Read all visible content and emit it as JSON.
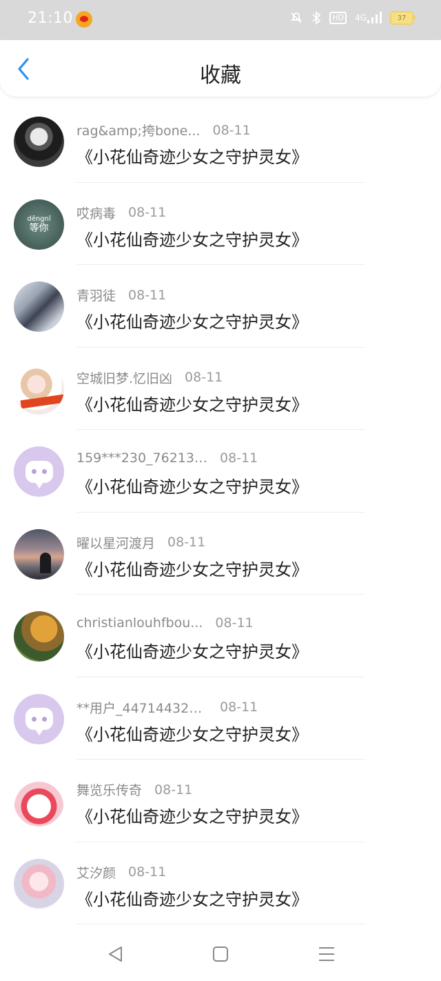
{
  "status_bar": {
    "time": "21:10",
    "icons": [
      "weibo-icon",
      "mute-icon",
      "bluetooth-icon",
      "hd-icon",
      "signal-4g-icon",
      "battery-icon"
    ],
    "hd_label": "HD",
    "network_label": "4G",
    "battery_level": "37"
  },
  "header": {
    "title": "收藏",
    "back_icon": "chevron-left-icon"
  },
  "favorites": [
    {
      "user": "rag&amp;挎bone...",
      "date": "08-11",
      "book": "《小花仙奇迹少女之守护灵女》"
    },
    {
      "user": "哎病毒",
      "date": "08-11",
      "book": "《小花仙奇迹少女之守护灵女》"
    },
    {
      "user": "青羽徒",
      "date": "08-11",
      "book": "《小花仙奇迹少女之守护灵女》"
    },
    {
      "user": "空城旧梦.忆旧凶",
      "date": "08-11",
      "book": "《小花仙奇迹少女之守护灵女》"
    },
    {
      "user": "159***230_762132...",
      "date": "08-11",
      "book": "《小花仙奇迹少女之守护灵女》"
    },
    {
      "user": "曜以星河渡月",
      "date": "08-11",
      "book": "《小花仙奇迹少女之守护灵女》"
    },
    {
      "user": "christianlouhfbou...",
      "date": "08-11",
      "book": "《小花仙奇迹少女之守护灵女》"
    },
    {
      "user": "**用户_447144323...",
      "date": "08-11",
      "book": "《小花仙奇迹少女之守护灵女》"
    },
    {
      "user": "舞览乐传奇",
      "date": "08-11",
      "book": "《小花仙奇迹少女之守护灵女》"
    },
    {
      "user": "艾汐颜",
      "date": "08-11",
      "book": "《小花仙奇迹少女之守护灵女》"
    }
  ],
  "avatar_texts": {
    "pinyin": "děngnǐ",
    "chars": "等你"
  },
  "nav_bar": {
    "back": "triangle-back-icon",
    "home": "square-home-icon",
    "menu": "menu-lines-icon"
  },
  "colors": {
    "accent_blue": "#2a8ff7",
    "status_bar_bg": "#d9d9d9",
    "default_avatar": "#d9c8ee"
  }
}
